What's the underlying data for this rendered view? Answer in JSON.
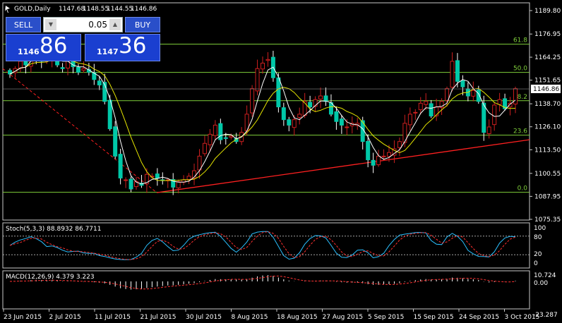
{
  "chart": {
    "symbol": "GOLD,Daily",
    "open": "1147.68",
    "high": "1148.55",
    "low": "1144.55",
    "close": "1146.86",
    "current_price_label": "1146.86"
  },
  "trade_panel": {
    "sell_label": "SELL",
    "buy_label": "BUY",
    "lot": "0.05",
    "sell_price_small": "1146",
    "sell_price_big": "86",
    "buy_price_small": "1147",
    "buy_price_big": "36"
  },
  "price_axis": [
    "1189.80",
    "1176.95",
    "1164.25",
    "1151.65",
    "1138.70",
    "1126.10",
    "1113.50",
    "1100.55",
    "1087.95",
    "1075.35"
  ],
  "fibonacci": {
    "levels": [
      {
        "label": "61.8",
        "price": 1171.4
      },
      {
        "label": "50.0",
        "price": 1155.9
      },
      {
        "label": "38.2",
        "price": 1140.4
      },
      {
        "label": "23.6",
        "price": 1121.5
      },
      {
        "label": "0.0",
        "price": 1090.2
      }
    ],
    "line_color": "#7fcf3a"
  },
  "stochastic": {
    "label": "Stoch(5,3,3) 88.8932 86.7711",
    "axis": [
      "100",
      "80",
      "20",
      "0"
    ]
  },
  "macd": {
    "label": "MACD(12,26,9) 4.379 3.223",
    "axis": [
      "10.724",
      "0.00",
      "-23.287"
    ]
  },
  "time_axis": [
    "23 Jun 2015",
    "2 Jul 2015",
    "11 Jul 2015",
    "21 Jul 2015",
    "30 Jul 2015",
    "8 Aug 2015",
    "18 Aug 2015",
    "27 Aug 2015",
    "5 Sep 2015",
    "15 Sep 2015",
    "24 Sep 2015",
    "3 Oct 2015"
  ],
  "colors": {
    "bull": "#cc1f1f",
    "bear": "#00c8a8",
    "ma_fast": "#ffffff",
    "ma_slow": "#e6e600",
    "trendline": "#ff2020",
    "panel_blue": "#1a3fd0"
  },
  "chart_data": {
    "type": "candlestick",
    "closes": [
      1155,
      1158,
      1162,
      1160,
      1168,
      1165,
      1162,
      1163,
      1167,
      1160,
      1158,
      1163,
      1159,
      1156,
      1158,
      1156,
      1152,
      1149,
      1140,
      1125,
      1110,
      1098,
      1097,
      1092,
      1096,
      1094,
      1100,
      1099,
      1098,
      1097,
      1097,
      1093,
      1096,
      1097,
      1099,
      1102,
      1110,
      1117,
      1122,
      1127,
      1119,
      1120,
      1121,
      1118,
      1123,
      1133,
      1147,
      1158,
      1161,
      1163,
      1153,
      1137,
      1130,
      1127,
      1130,
      1133,
      1140,
      1137,
      1141,
      1143,
      1140,
      1133,
      1129,
      1127,
      1126,
      1128,
      1128,
      1118,
      1108,
      1105,
      1110,
      1110,
      1112,
      1114,
      1118,
      1128,
      1133,
      1134,
      1139,
      1140,
      1132,
      1137,
      1140,
      1147,
      1162,
      1151,
      1148,
      1143,
      1146,
      1140,
      1123,
      1126,
      1138,
      1141,
      1136,
      1139,
      1147
    ]
  }
}
